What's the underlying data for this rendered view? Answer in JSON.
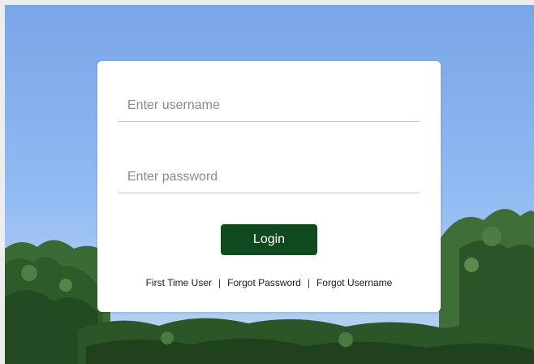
{
  "login": {
    "username_placeholder": "Enter username",
    "password_placeholder": "Enter password",
    "login_label": "Login"
  },
  "links": {
    "first_time_user": "First Time User",
    "separator": "|",
    "forgot_password": "Forgot Password",
    "forgot_username": "Forgot Username"
  },
  "colors": {
    "login_button": "#0f4a1f",
    "sky": "#86b1ee",
    "foliage": "#2f5a2a"
  }
}
